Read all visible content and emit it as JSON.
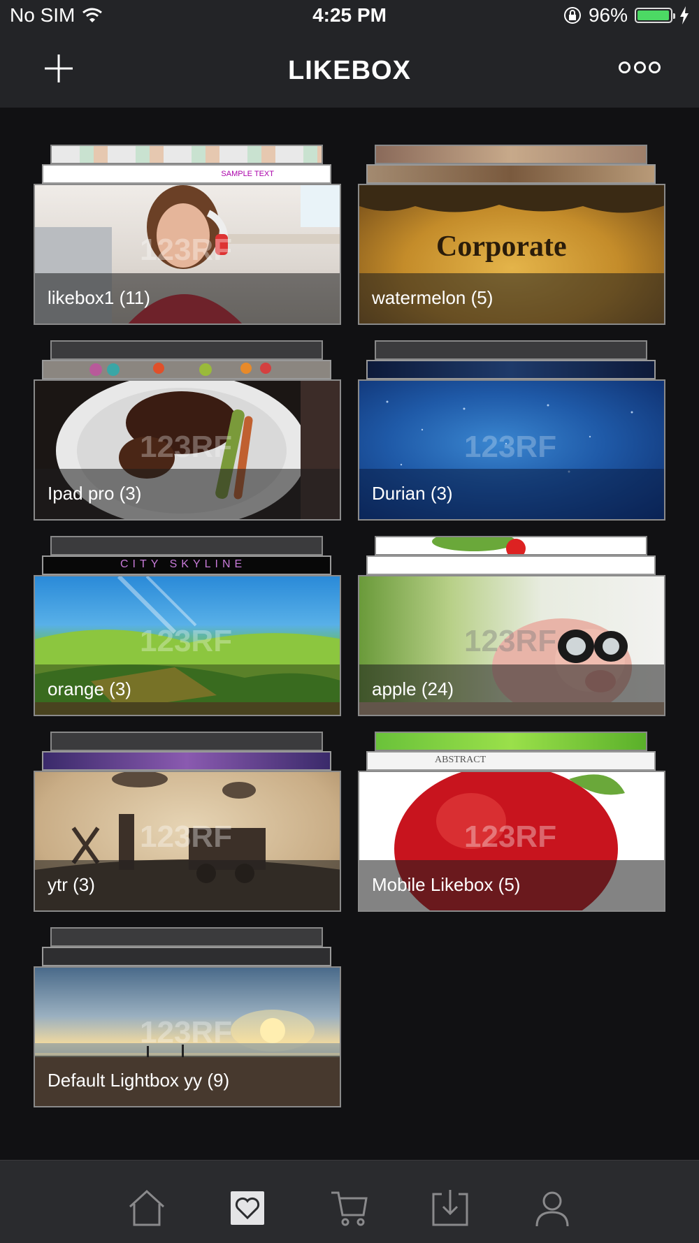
{
  "status_bar": {
    "carrier": "No SIM",
    "time": "4:25 PM",
    "battery": "96%"
  },
  "header": {
    "title": "LIKEBOX"
  },
  "likeboxes": [
    {
      "label": "likebox1 (11)"
    },
    {
      "label": "watermelon (5)"
    },
    {
      "label": "Ipad pro (3)"
    },
    {
      "label": "Durian (3)"
    },
    {
      "label": "orange (3)"
    },
    {
      "label": "apple (24)"
    },
    {
      "label": "ytr (3)"
    },
    {
      "label": "Mobile Likebox (5)"
    },
    {
      "label": "Default Lightbox yy (9)"
    }
  ],
  "thumbnail_text": {
    "watermark": "123RF",
    "corporate": "Corporate",
    "sample": "SAMPLE TEXT",
    "skyline": "CITY SKYLINE",
    "abstract": "ABSTRACT"
  },
  "tabbar": {
    "active": "likebox-icon"
  }
}
